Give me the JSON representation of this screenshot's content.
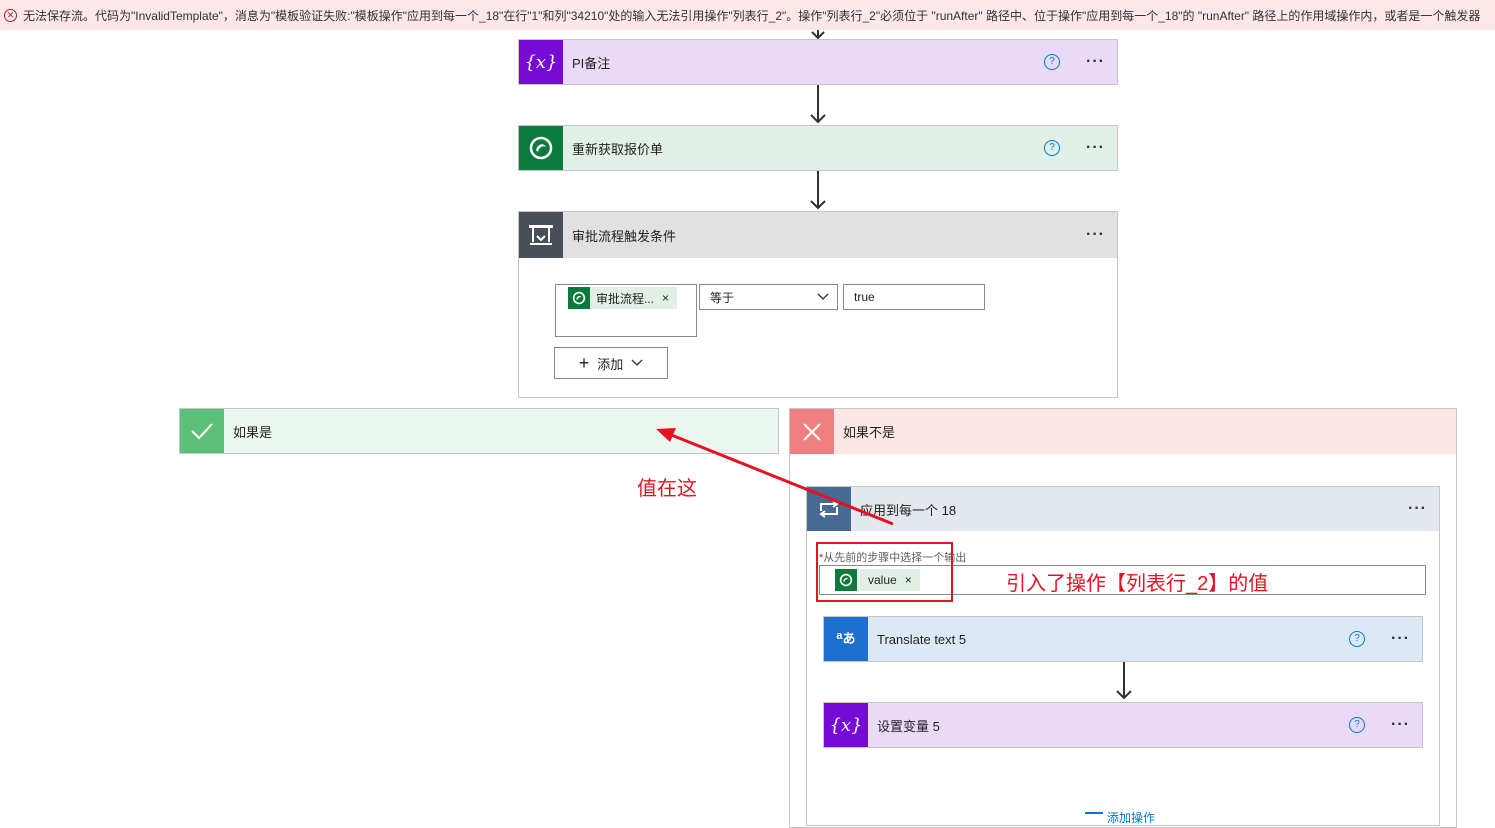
{
  "error_bar": {
    "message": "无法保存流。代码为\"InvalidTemplate\"，消息为\"模板验证失败:\"模板操作\"应用到每一个_18\"在行\"1\"和列\"34210\"处的输入无法引用操作\"列表行_2\"。操作\"列表行_2\"必须位于 \"runAfter\" 路径中、位于操作\"应用到每一个_18\"的 \"runAfter\" 路径上的作用域操作内，或者是一个触发器"
  },
  "steps": {
    "pi_note": {
      "title": "PI备注",
      "help": "?",
      "more": "···"
    },
    "refetch_quote": {
      "title": "重新获取报价单",
      "help": "?",
      "more": "···"
    },
    "condition": {
      "title": "审批流程触发条件",
      "more": "···",
      "token_label": "审批流程...",
      "token_remove": "×",
      "operator": "等于",
      "value": "true",
      "add_label": "添加"
    }
  },
  "branches": {
    "yes": {
      "title": "如果是"
    },
    "no": {
      "title": "如果不是"
    }
  },
  "apply_each": {
    "title": "应用到每一个 18",
    "more": "···",
    "field_required": "*",
    "field_label": "从先前的步骤中选择一个输出",
    "token_label": "value",
    "token_remove": "×"
  },
  "inner_steps": {
    "translate": {
      "title": "Translate text 5",
      "help": "?",
      "more": "···"
    },
    "set_var": {
      "title": "设置变量 5",
      "help": "?",
      "more": "···"
    },
    "add_action": "添加操作"
  },
  "annotations": {
    "here": "值在这",
    "ref_note": "引入了操作【列表行_2】的值"
  },
  "colors": {
    "variable": "#770bd6",
    "variable_bg": "#e9dbf8",
    "dataverse": "#0b7a3c",
    "dataverse_bg": "#e0f0e6",
    "condition": "#484f58",
    "condition_bg": "#e1e1e1",
    "yes": "#5cc07a",
    "yes_bg": "#eaf6ee",
    "no": "#f08080",
    "no_bg": "#fde6e6",
    "loop": "#486991",
    "loop_bg": "#e3e7ee",
    "translator": "#1f6fd1",
    "translator_bg": "#dce8f5",
    "annotation": "#e81123"
  }
}
